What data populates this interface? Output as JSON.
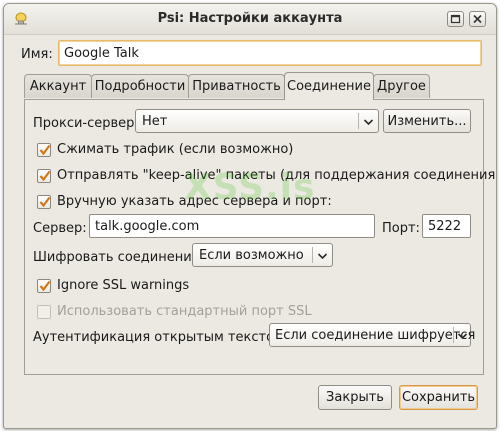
{
  "window": {
    "title": "Psi: Настройки аккаунта",
    "buttons": [
      "maximize",
      "close"
    ]
  },
  "name_field": {
    "label": "Имя:",
    "value": "Google Talk"
  },
  "tabs": [
    {
      "label": "Аккаунт",
      "active": false
    },
    {
      "label": "Подробности",
      "active": false
    },
    {
      "label": "Приватность",
      "active": false
    },
    {
      "label": "Соединение",
      "active": true
    },
    {
      "label": "Другое",
      "active": false
    }
  ],
  "connection": {
    "proxy": {
      "label": "Прокси-сервер:",
      "selected": "Нет",
      "edit_button": "Изменить..."
    },
    "compress": {
      "label": "Сжимать трафик (если возможно)",
      "checked": true
    },
    "keepalive": {
      "label": "Отправлять \"keep-alive\" пакеты (для поддержания соединения)",
      "checked": true
    },
    "manual_host": {
      "label": "Вручную указать адрес сервера и порт:",
      "checked": true
    },
    "server": {
      "label": "Сервер:",
      "value": "talk.google.com"
    },
    "port": {
      "label": "Порт:",
      "value": "5222"
    },
    "encrypt": {
      "label": "Шифровать соединение:",
      "selected": "Если возможно"
    },
    "ignore_ssl": {
      "label": "Ignore SSL warnings",
      "checked": true
    },
    "legacy_ssl": {
      "label": "Использовать стандартный порт SSL",
      "checked": false,
      "enabled": false
    },
    "plain_auth": {
      "label": "Аутентификация открытым текстом:",
      "selected": "Если соединение шифруется"
    }
  },
  "footer": {
    "close_button": "Закрыть",
    "save_button": "Сохранить"
  },
  "watermark": "XSS.is",
  "colors": {
    "window_bg": "#ece9e2",
    "check_mark": "#d0781a",
    "focus_border": "#e6b86a",
    "watermark": "#3fc41a"
  },
  "icons": {
    "app": "psi-lightbulb-icon",
    "maximize": "maximize-icon",
    "close": "close-icon",
    "dropdown": "chevron-down-icon",
    "check": "checkmark-icon"
  }
}
